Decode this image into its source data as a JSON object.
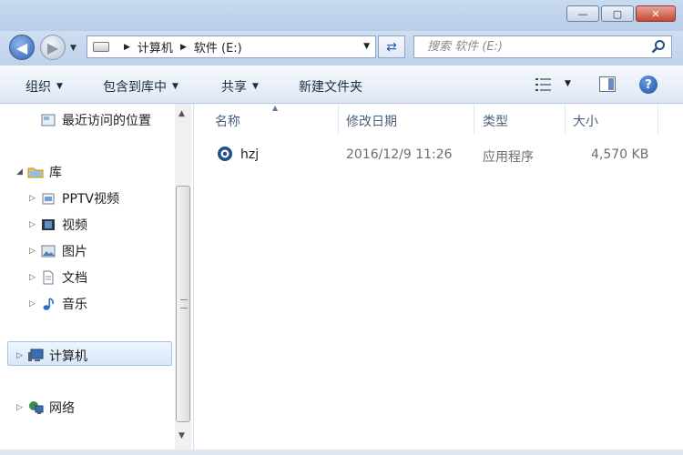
{
  "window": {
    "controls": {
      "minimize": "—",
      "maximize": "▢",
      "close": "✕"
    }
  },
  "address": {
    "crumbs": [
      "计算机",
      "软件 (E:)"
    ],
    "search_placeholder": "搜索 软件 (E:)"
  },
  "toolbar": {
    "organize": "组织",
    "include_library": "包含到库中",
    "share": "共享",
    "new_folder": "新建文件夹"
  },
  "nav": {
    "recent": "最近访问的位置",
    "libraries": "库",
    "library_items": [
      "PPTV视频",
      "视频",
      "图片",
      "文档",
      "音乐"
    ],
    "computer": "计算机",
    "network": "网络"
  },
  "columns": {
    "name": "名称",
    "modified": "修改日期",
    "type": "类型",
    "size": "大小"
  },
  "files": [
    {
      "name": "hzj",
      "modified": "2016/12/9 11:26",
      "type": "应用程序",
      "size": "4,570 KB"
    }
  ],
  "colors": {
    "accent": "#2c63b8",
    "selection": "#d7e7f9"
  }
}
